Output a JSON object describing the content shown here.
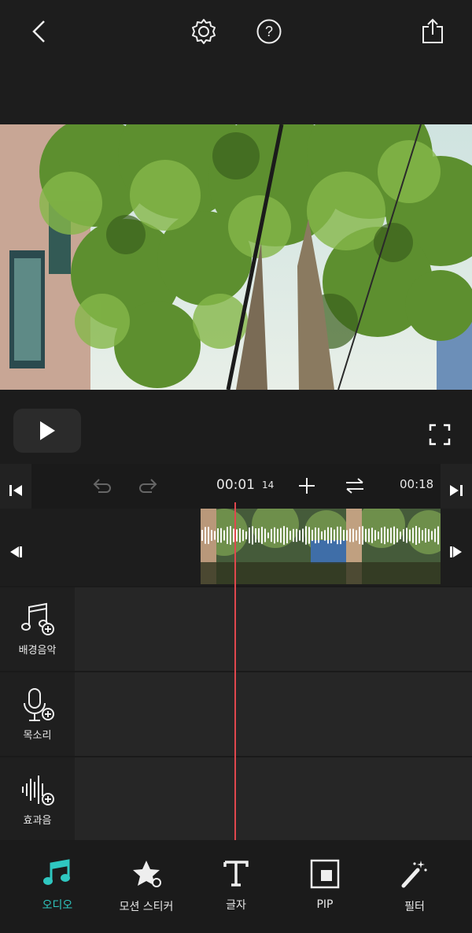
{
  "topbar": {
    "icons": [
      "back-icon",
      "settings-icon",
      "help-icon",
      "share-icon"
    ]
  },
  "player": {
    "play_icon": "play-icon",
    "fullscreen_icon": "fullscreen-icon"
  },
  "timeline": {
    "current_time": "00:01",
    "current_frame": "14",
    "total_time": "00:18",
    "playhead_color": "#e0474e"
  },
  "tracks": [
    {
      "label": "배경음악",
      "icon": "music-add-icon"
    },
    {
      "label": "목소리",
      "icon": "mic-add-icon"
    },
    {
      "label": "효과음",
      "icon": "sound-effect-add-icon"
    }
  ],
  "bottom_nav": {
    "accent": "#2fc7c0",
    "items": [
      {
        "label": "오디오",
        "icon": "music-note-icon",
        "active": true
      },
      {
        "label": "모션 스티커",
        "icon": "star-sticker-icon",
        "active": false
      },
      {
        "label": "글자",
        "icon": "text-icon",
        "active": false
      },
      {
        "label": "PIP",
        "icon": "pip-icon",
        "active": false
      },
      {
        "label": "필터",
        "icon": "magic-wand-icon",
        "active": false
      }
    ]
  }
}
